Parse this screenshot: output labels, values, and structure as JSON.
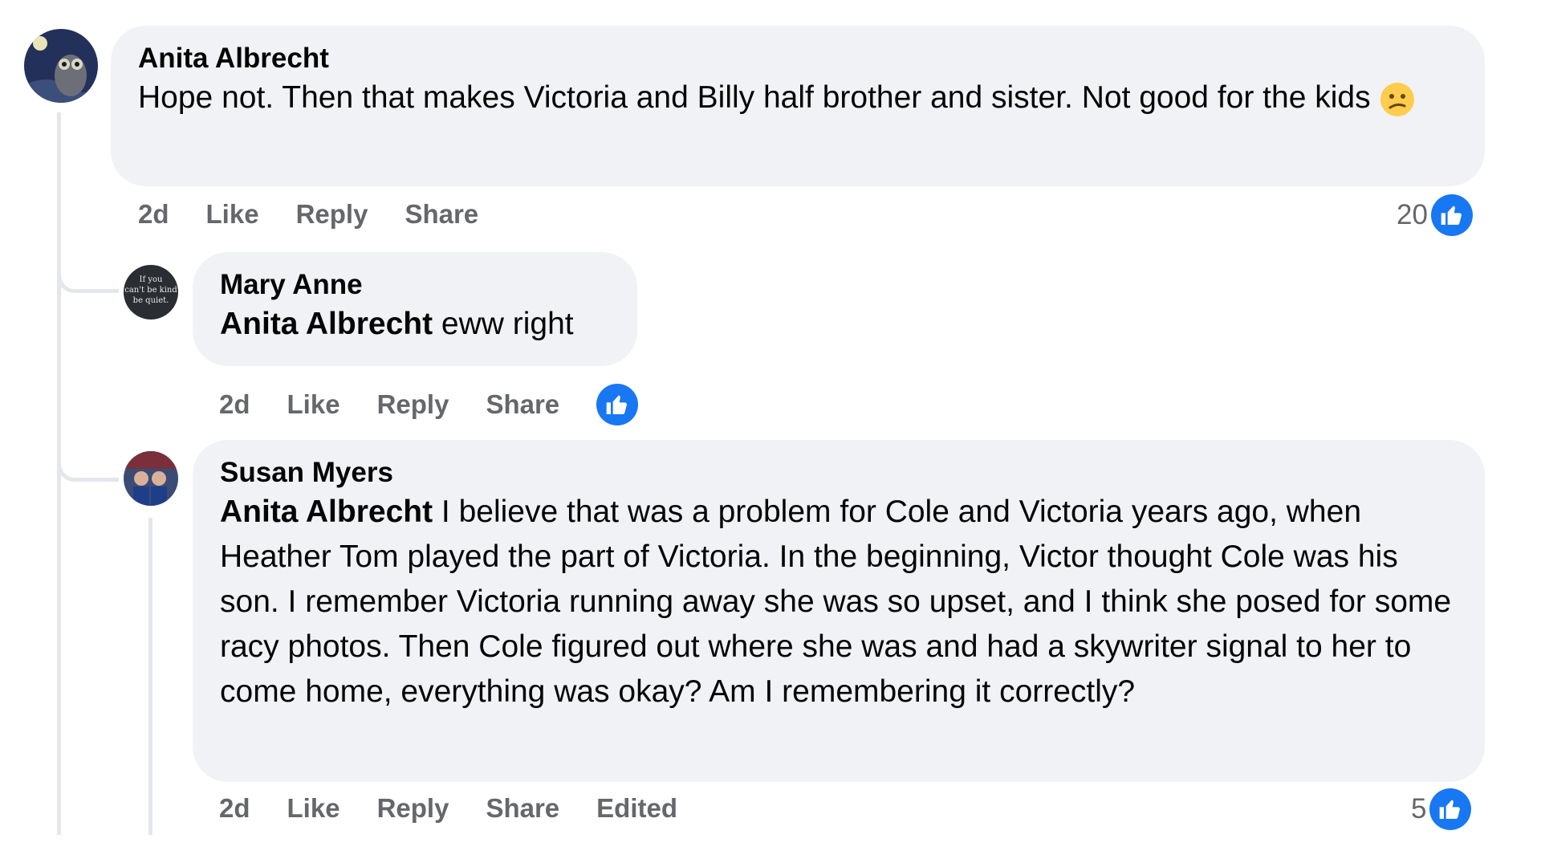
{
  "comments": [
    {
      "author": "Anita Albrecht",
      "text": "Hope not. Then that makes Victoria and Billy half brother and sister. Not good for the kids",
      "emoji": "confused-face",
      "actions": {
        "time": "2d",
        "like": "Like",
        "reply": "Reply",
        "share": "Share"
      },
      "reaction_count": "20"
    },
    {
      "author": "Mary Anne",
      "mention": "Anita Albrecht",
      "text": "eww right",
      "avatar_text": [
        "If you",
        "can't be kind",
        "be quiet."
      ],
      "actions": {
        "time": "2d",
        "like": "Like",
        "reply": "Reply",
        "share": "Share"
      }
    },
    {
      "author": "Susan Myers",
      "mention": "Anita Albrecht",
      "text": "I believe that was a problem for Cole and Victoria years ago, when Heather Tom played the part of Victoria. In the beginning, Victor thought Cole was his son. I remember Victoria running away she was so upset, and I think she posed for some racy photos. Then Cole figured out where she was and had a skywriter signal to her to come home, everything was okay? Am I remembering it correctly?",
      "actions": {
        "time": "2d",
        "like": "Like",
        "reply": "Reply",
        "share": "Share",
        "edited": "Edited"
      },
      "reaction_count": "5"
    }
  ],
  "colors": {
    "bubble": "#f0f2f5",
    "like_blue": "#1877f2",
    "meta_gray": "#65676b",
    "thread_line": "#e4e6eb"
  },
  "icons": {
    "reaction": "thumbs-up-icon"
  }
}
